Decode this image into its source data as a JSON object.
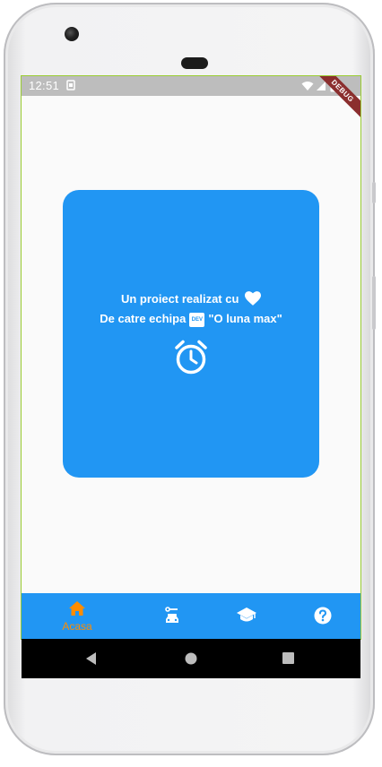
{
  "status_bar": {
    "time": "12:51",
    "debug_ribbon": "DEBUG",
    "icons": [
      "sim-icon",
      "wifi-icon",
      "battery-icon"
    ]
  },
  "card": {
    "color": "#2196f3",
    "line1": "Un proiect realizat cu",
    "line2_prefix": "De catre echipa",
    "dev_badge": "DEV",
    "line2_suffix": "\"O luna max\"",
    "icons": [
      "heart-icon",
      "dev-icon",
      "alarm-clock-icon"
    ]
  },
  "bottom_nav": {
    "color": "#2196f3",
    "active_color": "#ff8c00",
    "items": [
      {
        "icon": "home-icon",
        "label": "Acasa",
        "active": true
      },
      {
        "icon": "car-service-icon",
        "label": "",
        "active": false
      },
      {
        "icon": "graduation-cap-icon",
        "label": "",
        "active": false
      },
      {
        "icon": "help-icon",
        "label": "",
        "active": false
      }
    ]
  },
  "system_nav": {
    "icons": [
      "back-icon",
      "home-circle-icon",
      "recents-icon"
    ]
  }
}
